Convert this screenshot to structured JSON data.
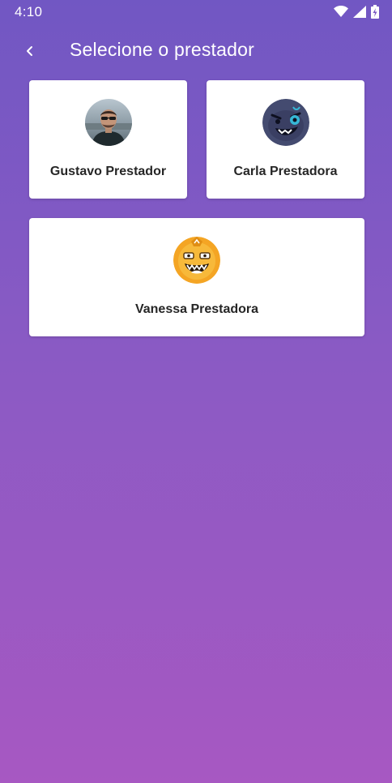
{
  "status_bar": {
    "time": "4:10",
    "icons": [
      "wifi-icon",
      "signal-icon",
      "battery-charging-icon"
    ]
  },
  "header": {
    "back_icon": "chevron-left-icon",
    "title": "Selecione o prestador"
  },
  "providers": [
    {
      "name": "Gustavo Prestador",
      "avatar": "photo-avatar-man-sunglasses"
    },
    {
      "name": "Carla Prestadora",
      "avatar": "cartoon-avatar-blue-face"
    },
    {
      "name": "Vanessa Prestadora",
      "avatar": "cartoon-avatar-orange-face"
    }
  ],
  "colors": {
    "gradient_top": "#7157c3",
    "gradient_bottom": "#a758c2",
    "card_background": "#ffffff",
    "card_text": "#262626"
  }
}
